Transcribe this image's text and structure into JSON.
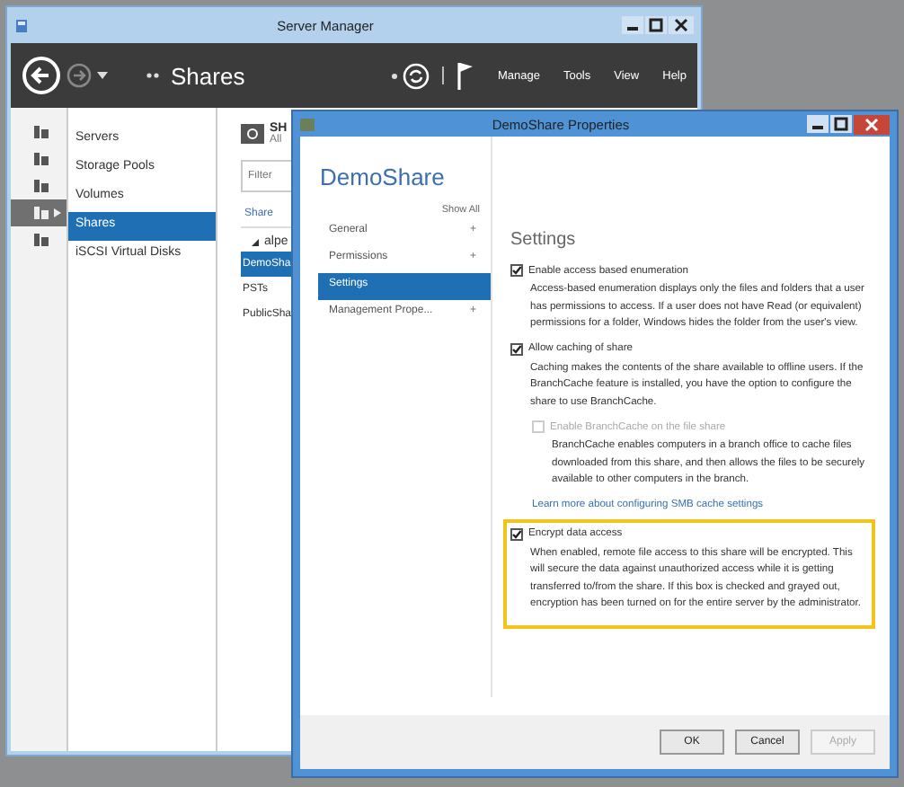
{
  "server_manager": {
    "title": "Server Manager",
    "breadcrumb": "Shares",
    "menu": [
      "Manage",
      "Tools",
      "View",
      "Help"
    ],
    "rail": [
      {
        "selected": false
      },
      {
        "selected": false
      },
      {
        "selected": false
      },
      {
        "selected": true
      },
      {
        "selected": false
      }
    ],
    "nav": [
      {
        "label": "Servers",
        "selected": false
      },
      {
        "label": "Storage Pools",
        "selected": false
      },
      {
        "label": "Volumes",
        "selected": false
      },
      {
        "label": "Shares",
        "selected": true
      },
      {
        "label": "iSCSI Virtual Disks",
        "selected": false
      }
    ],
    "shares_pane": {
      "title": "SH",
      "subtitle": "All",
      "filter_placeholder": "Filter",
      "column": "Share",
      "group": "alpe",
      "rows": [
        {
          "label": "DemoSha",
          "selected": true
        },
        {
          "label": "PSTs",
          "selected": false
        },
        {
          "label": "PublicSha",
          "selected": false
        }
      ]
    }
  },
  "dialog": {
    "title": "DemoShare Properties",
    "heading": "DemoShare",
    "show_all": "Show All",
    "nav": [
      {
        "label": "General",
        "expander": "+",
        "selected": false
      },
      {
        "label": "Permissions",
        "expander": "+",
        "selected": false
      },
      {
        "label": "Settings",
        "selected": true
      },
      {
        "label": "Management Prope...",
        "expander": "+",
        "selected": false
      }
    ],
    "section_title": "Settings",
    "options": [
      {
        "label": "Enable access based enumeration",
        "checked": true,
        "disabled": false,
        "indented": false,
        "highlighted": false,
        "description": "Access-based enumeration displays only the files and folders that a user has permissions to access. If a user does not have Read (or equivalent) permissions for a folder, Windows hides the folder from the user's view."
      },
      {
        "label": "Allow caching of share",
        "checked": true,
        "disabled": false,
        "indented": false,
        "highlighted": false,
        "description": "Caching makes the contents of the share available to offline users. If the BranchCache feature is installed, you have the option to configure the share to use BranchCache."
      },
      {
        "label": "Enable BranchCache on the file share",
        "checked": false,
        "disabled": true,
        "indented": true,
        "highlighted": false,
        "description": "BranchCache enables computers in a branch office to cache files downloaded from this share, and then allows the files to be securely available to other computers in the branch.",
        "link": "Learn more about configuring SMB cache settings"
      },
      {
        "label": "Encrypt data access",
        "checked": true,
        "disabled": false,
        "indented": false,
        "highlighted": true,
        "description": "When enabled, remote file access to this share will be encrypted. This will secure the data against unauthorized access while it is getting transferred to/from the share. If this box is checked and grayed out, encryption has been turned on for the entire server by the administrator."
      }
    ],
    "buttons": [
      {
        "label": "OK",
        "disabled": false
      },
      {
        "label": "Cancel",
        "disabled": false
      },
      {
        "label": "Apply",
        "disabled": true
      }
    ]
  }
}
